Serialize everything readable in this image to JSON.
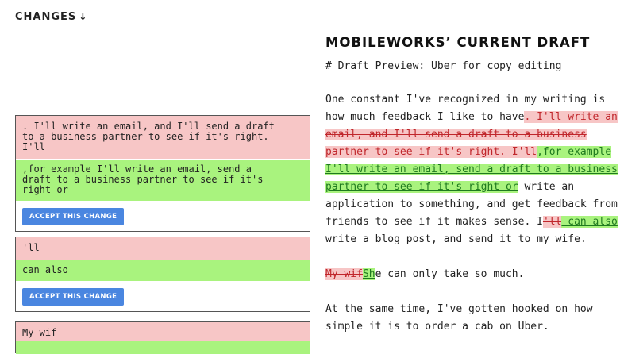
{
  "header": {
    "title": "CHANGES",
    "arrow_icon": "↓"
  },
  "changes": [
    {
      "old": ". I'll write an email, and I'll send a draft\nto a business partner to see if it's right.\nI'll",
      "new": ",for example I'll write an email, send a\ndraft to a business partner to see if it's\nright or",
      "accept_label": "ACCEPT THIS CHANGE"
    },
    {
      "old": "'ll",
      "new": "can also",
      "accept_label": "ACCEPT THIS CHANGE"
    },
    {
      "old": "My wif",
      "new": "",
      "accept_label": ""
    }
  ],
  "draft": {
    "title": "MOBILEWORKS’ CURRENT DRAFT",
    "preview_line": "# Draft Preview: Uber for copy editing",
    "p1": {
      "t1": "One constant I've recognized in my writing is how much feedback I like to have",
      "d1": ". I'll write an email, and I'll send a draft to a business partner to see if it's right. I'll",
      "i1": ",for example I'll write an email, send a draft to a business partner to see if it's right or",
      "t2": " write an application to something, and get feedback from friends to see if it makes sense. I",
      "d2": "'ll",
      "i2": " can also",
      "t3": " write a blog post, and send it to my wife."
    },
    "p2": {
      "d1": "My wif",
      "i1": "Sh",
      "t1": "e can only take so much."
    },
    "p3": {
      "t1": "At the same time, I've gotten hooked on how simple it is to order a cab on Uber."
    }
  },
  "colors": {
    "deleted_bg": "#f7c6c6",
    "inserted_bg": "#a9f37e",
    "accept_button": "#4a86e0"
  }
}
